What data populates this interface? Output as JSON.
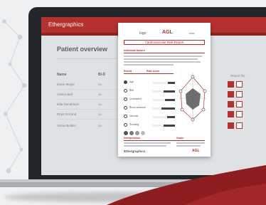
{
  "app": {
    "brand": "Ethergraphics",
    "page_title": "Patient overview",
    "columns": [
      "Name",
      "BI-D",
      "Report file"
    ],
    "patients": [
      {
        "name": "Ewan Moyer",
        "value": "aa"
      },
      {
        "name": "Ariana Bell",
        "value": "aa"
      },
      {
        "name": "Mila Donaldson",
        "value": "aa"
      },
      {
        "name": "Rhys Ferrand",
        "value": "aa"
      },
      {
        "name": "Jamie Bolder",
        "value": "aa"
      }
    ]
  },
  "report": {
    "brand": "AGL",
    "header_left": "logo",
    "header_right": "date",
    "title": "Cardiovascular Risk Report",
    "sections": [
      "Individual factors",
      "Result",
      "Risk score",
      "Interpretation",
      "Goals"
    ],
    "score_labels": [
      "Age",
      "BMI",
      "Cholesterol",
      "Blood pressure",
      "Glucose",
      "Smoking"
    ],
    "score_levels": [
      0.3,
      0.5,
      0.45,
      0.6,
      0.35,
      0.5
    ],
    "footer_brand": "Ethergraphics",
    "footer_logo": "AGL"
  },
  "colors": {
    "accent": "#b5312d",
    "dark": "#22262b",
    "sheet": "#ffffff"
  }
}
